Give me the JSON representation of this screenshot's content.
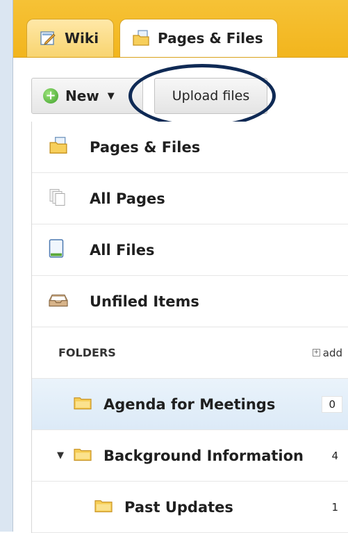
{
  "tabs": [
    {
      "label": "Wiki",
      "icon": "wiki-edit-icon"
    },
    {
      "label": "Pages & Files",
      "icon": "pages-files-icon"
    }
  ],
  "toolbar": {
    "new_label": "New",
    "upload_label": "Upload files"
  },
  "nav": [
    {
      "label": "Pages & Files",
      "icon": "pages-files-icon"
    },
    {
      "label": "All Pages",
      "icon": "all-pages-icon"
    },
    {
      "label": "All Files",
      "icon": "file-icon"
    },
    {
      "label": "Unfiled Items",
      "icon": "inbox-tray-icon"
    }
  ],
  "folders_header": {
    "label": "FOLDERS",
    "add_label": "add"
  },
  "folders": [
    {
      "label": "Agenda for Meetings",
      "count": "0",
      "selected": true
    },
    {
      "label": "Background Information",
      "count": "4",
      "expanded": true
    },
    {
      "label": "Past Updates",
      "count": "1"
    }
  ],
  "colors": {
    "tabbar": "#f2b51d",
    "highlight_ring": "#0f2a55",
    "selected_row": "#dceaf7"
  }
}
